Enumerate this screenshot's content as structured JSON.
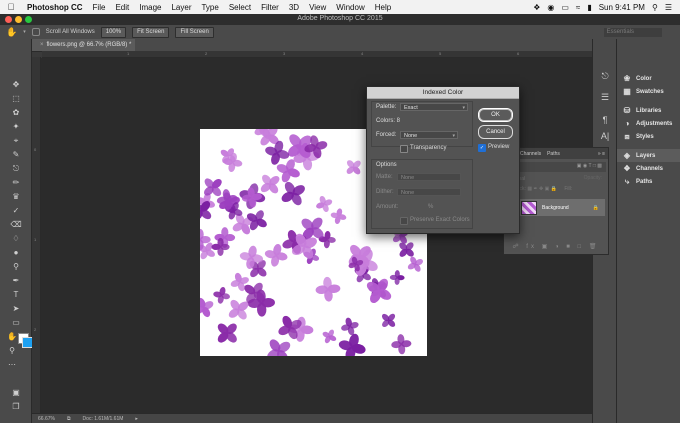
{
  "menubar": {
    "app": "Photoshop CC",
    "items": [
      "File",
      "Edit",
      "Image",
      "Layer",
      "Type",
      "Select",
      "Filter",
      "3D",
      "View",
      "Window",
      "Help"
    ],
    "clock": "Sun 9:41 PM"
  },
  "window": {
    "title": "Adobe Photoshop CC 2015"
  },
  "options_bar": {
    "scroll_all_windows": "Scroll All Windows",
    "zoom_100": "100%",
    "fit_screen": "Fit Screen",
    "fill_screen": "Fill Screen",
    "workspace": "Essentials"
  },
  "document": {
    "tab_label": "flowers.png @ 66.7% (RGB/8) *",
    "status_zoom": "66.67%",
    "status_doc": "Doc: 1.61M/1.61M",
    "ruler_h": [
      "1",
      "2",
      "3",
      "4",
      "5",
      "6"
    ],
    "ruler_v": [
      "0",
      "1",
      "2"
    ]
  },
  "dialog": {
    "title": "Indexed Color",
    "palette_label": "Palette:",
    "palette_value": "Exact",
    "colors_label": "Colors: 8",
    "forced_label": "Forced:",
    "forced_value": "None",
    "transparency_label": "Transparency",
    "options_label": "Options",
    "matte_label": "Matte:",
    "matte_value": "None",
    "dither_label": "Dither:",
    "dither_value": "None",
    "amount_label": "Amount:",
    "amount_unit": "%",
    "preserve_label": "Preserve Exact Colors",
    "ok_label": "OK",
    "cancel_label": "Cancel",
    "preview_label": "Preview"
  },
  "layers_panel": {
    "tabs": [
      "ers",
      "Channels",
      "Paths"
    ],
    "kind": "Kind",
    "normal": "Normal",
    "opacity": "Opacity:",
    "lock": "Lock:",
    "fill": "Fill:",
    "layer_name": "Background"
  },
  "right_panel": {
    "items": [
      {
        "label": "Color",
        "icon": "color-wheel-icon"
      },
      {
        "label": "Swatches",
        "icon": "swatches-grid-icon"
      },
      {
        "label": "Libraries",
        "icon": "libraries-icon"
      },
      {
        "label": "Adjustments",
        "icon": "adjustments-icon"
      },
      {
        "label": "Styles",
        "icon": "styles-icon"
      },
      {
        "label": "Layers",
        "icon": "layers-icon"
      },
      {
        "label": "Channels",
        "icon": "channels-icon"
      },
      {
        "label": "Paths",
        "icon": "paths-icon"
      }
    ]
  },
  "colors": {
    "foreground": "#ffffff",
    "background": "#1da1f2",
    "flower_dark": "#7b1fa2",
    "flower_light": "#c77ddb"
  }
}
